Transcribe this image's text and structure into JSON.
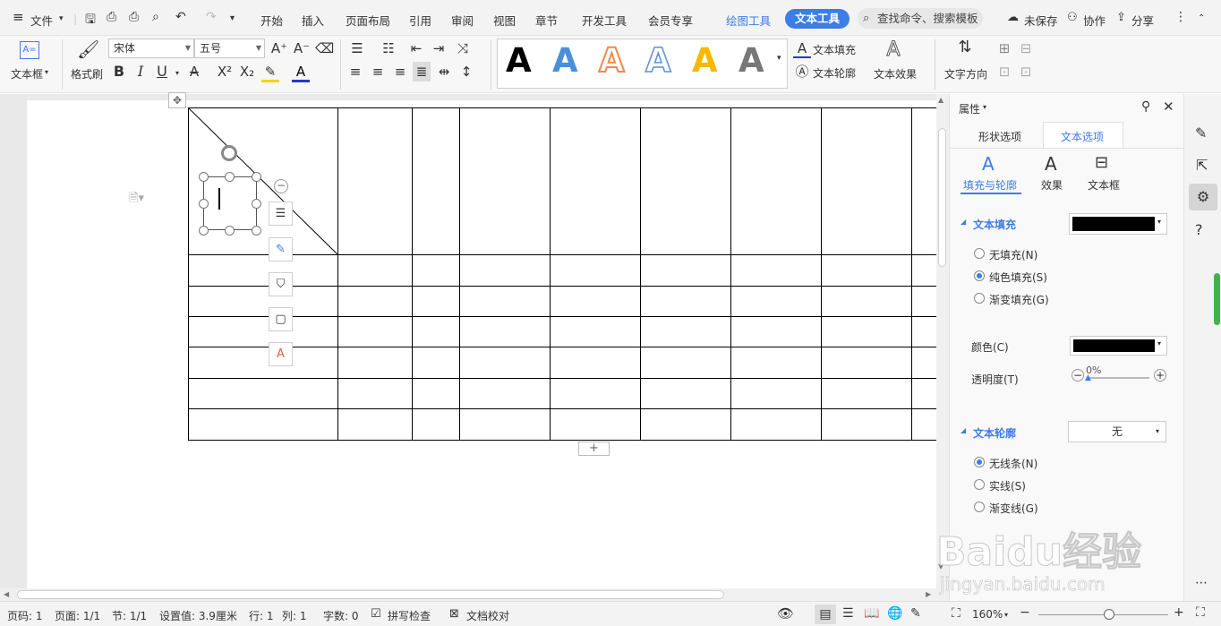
{
  "menu": {
    "file_label": "文件",
    "tabs": [
      "开始",
      "插入",
      "页面布局",
      "引用",
      "审阅",
      "视图",
      "章节",
      "开发工具",
      "会员专享"
    ],
    "drawing_tools": "绘图工具",
    "text_tools": "文本工具",
    "search_placeholder": "查找命令、搜索模板",
    "unsaved": "未保存",
    "collaborate": "协作",
    "share": "分享"
  },
  "ribbon": {
    "textbox_label": "文本框",
    "format_painter_label": "格式刷",
    "font_name": "宋体",
    "font_size": "五号",
    "text_fill": "文本填充",
    "text_outline": "文本轮廓",
    "text_effect": "文本效果",
    "text_direction": "文字方向",
    "style_letter": "A",
    "style_colors": [
      "#000000",
      "#4a90d9",
      "#f08a4b",
      "#5b8fd6",
      "#f5b800",
      "#777777"
    ]
  },
  "panel": {
    "title": "属性",
    "tab_shape": "形状选项",
    "tab_text": "文本选项",
    "sub_fill_outline": "填充与轮廓",
    "sub_effect": "效果",
    "sub_textbox": "文本框",
    "text_fill_header": "文本填充",
    "fill_options": [
      "无填充(N)",
      "纯色填充(S)",
      "渐变填充(G)"
    ],
    "fill_selected_index": 1,
    "color_label": "颜色(C)",
    "transparency_label": "透明度(T)",
    "transparency_value": "0%",
    "transparency_fraction": 0,
    "text_outline_header": "文本轮廓",
    "outline_value": "无",
    "outline_options": [
      "无线条(N)",
      "实线(S)",
      "渐变线(G)"
    ],
    "outline_selected_index": 0,
    "fill_color": "#000000"
  },
  "status": {
    "page_num": "页码: 1",
    "pages": "页面: 1/1",
    "section": "节: 1/1",
    "setting": "设置值: 3.9厘米",
    "row": "行: 1",
    "col": "列: 1",
    "word_count": "字数: 0",
    "spell_check": "拼写检查",
    "doc_proof": "文档校对",
    "zoom": "160%"
  },
  "watermark": {
    "brand": "Baidu经验",
    "url": "jingyan.baidu.com"
  }
}
